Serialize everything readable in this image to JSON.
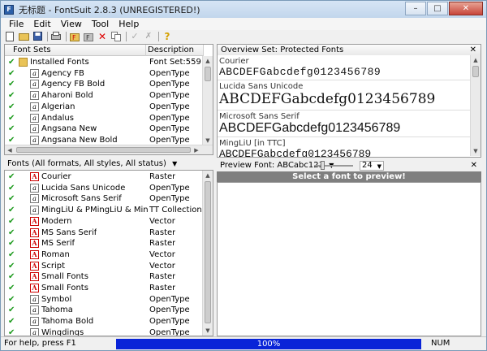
{
  "window": {
    "title": "无标题 - FontSuit 2.8.3 (UNREGISTERED!)"
  },
  "menu": [
    "File",
    "Edit",
    "View",
    "Tool",
    "Help"
  ],
  "font_sets": {
    "headers": {
      "name": "Font Sets",
      "desc": "Description"
    },
    "rows": [
      {
        "name": "Installed Fonts",
        "desc": "Font Set:559 font",
        "type": "folder"
      },
      {
        "name": "Agency FB",
        "desc": "OpenType",
        "type": "ot"
      },
      {
        "name": "Agency FB Bold",
        "desc": "OpenType",
        "type": "ot"
      },
      {
        "name": "Aharoni Bold",
        "desc": "OpenType",
        "type": "ot"
      },
      {
        "name": "Algerian",
        "desc": "OpenType",
        "type": "ot"
      },
      {
        "name": "Andalus",
        "desc": "OpenType",
        "type": "ot"
      },
      {
        "name": "Angsana New",
        "desc": "OpenType",
        "type": "ot"
      },
      {
        "name": "Angsana New Bold",
        "desc": "OpenType",
        "type": "ot"
      }
    ]
  },
  "fonts_filter_label": "Fonts (All formats, All styles, All status)",
  "fonts_list": [
    {
      "name": "Courier",
      "desc": "Raster",
      "type": "raster"
    },
    {
      "name": "Lucida Sans Unicode",
      "desc": "OpenType",
      "type": "ot"
    },
    {
      "name": "Microsoft Sans Serif",
      "desc": "OpenType",
      "type": "ot"
    },
    {
      "name": "MingLiU & PMingLiU & MingLiU_H",
      "desc": "TT Collection",
      "type": "ot"
    },
    {
      "name": "Modern",
      "desc": "Vector",
      "type": "raster"
    },
    {
      "name": "MS Sans Serif",
      "desc": "Raster",
      "type": "raster"
    },
    {
      "name": "MS Serif",
      "desc": "Raster",
      "type": "raster"
    },
    {
      "name": "Roman",
      "desc": "Vector",
      "type": "raster"
    },
    {
      "name": "Script",
      "desc": "Vector",
      "type": "raster"
    },
    {
      "name": "Small Fonts",
      "desc": "Raster",
      "type": "raster"
    },
    {
      "name": "Small Fonts",
      "desc": "Raster",
      "type": "raster"
    },
    {
      "name": "Symbol",
      "desc": "OpenType",
      "type": "ot"
    },
    {
      "name": "Tahoma",
      "desc": "OpenType",
      "type": "ot"
    },
    {
      "name": "Tahoma Bold",
      "desc": "OpenType",
      "type": "ot"
    },
    {
      "name": "Wingdings",
      "desc": "OpenType",
      "type": "ot"
    }
  ],
  "overview": {
    "title": "Overview Set: Protected Fonts",
    "sample_text": "ABCDEFGabcdefg0123456789",
    "items": [
      {
        "name": "Courier"
      },
      {
        "name": "Lucida Sans Unicode"
      },
      {
        "name": "Microsoft Sans Serif"
      },
      {
        "name": "MingLiU [in TTC]"
      }
    ]
  },
  "preview": {
    "label": "Preview Font: ABCabc123",
    "size": "24",
    "banner": "Select a font to preview!"
  },
  "status": {
    "help": "For help, press F1",
    "progress": "100%",
    "num": "NUM"
  }
}
